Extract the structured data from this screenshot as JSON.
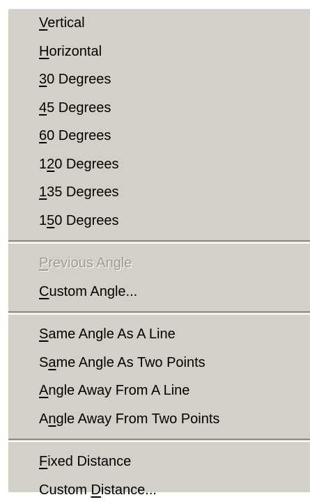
{
  "menu": {
    "groups": [
      {
        "items": [
          {
            "name": "menu-item-vertical",
            "pre": "",
            "key": "V",
            "post": "ertical",
            "enabled": true
          },
          {
            "name": "menu-item-horizontal",
            "pre": "",
            "key": "H",
            "post": "orizontal",
            "enabled": true
          },
          {
            "name": "menu-item-30-degrees",
            "pre": "",
            "key": "3",
            "post": "0 Degrees",
            "enabled": true
          },
          {
            "name": "menu-item-45-degrees",
            "pre": "",
            "key": "4",
            "post": "5 Degrees",
            "enabled": true
          },
          {
            "name": "menu-item-60-degrees",
            "pre": "",
            "key": "6",
            "post": "0 Degrees",
            "enabled": true
          },
          {
            "name": "menu-item-120-degrees",
            "pre": "1",
            "key": "2",
            "post": "0 Degrees",
            "enabled": true
          },
          {
            "name": "menu-item-135-degrees",
            "pre": "",
            "key": "1",
            "post": "35 Degrees",
            "enabled": true
          },
          {
            "name": "menu-item-150-degrees",
            "pre": "1",
            "key": "5",
            "post": "0 Degrees",
            "enabled": true
          }
        ]
      },
      {
        "items": [
          {
            "name": "menu-item-previous-angle",
            "pre": "",
            "key": "P",
            "post": "revious Angle",
            "enabled": false
          },
          {
            "name": "menu-item-custom-angle",
            "pre": "",
            "key": "C",
            "post": "ustom Angle...",
            "enabled": true
          }
        ]
      },
      {
        "items": [
          {
            "name": "menu-item-same-angle-as-a-line",
            "pre": "",
            "key": "S",
            "post": "ame Angle As A Line",
            "enabled": true
          },
          {
            "name": "menu-item-same-angle-as-two-points",
            "pre": "S",
            "key": "a",
            "post": "me Angle As Two Points",
            "enabled": true
          },
          {
            "name": "menu-item-angle-away-from-a-line",
            "pre": "",
            "key": "A",
            "post": "ngle Away From A Line",
            "enabled": true
          },
          {
            "name": "menu-item-angle-away-from-two-points",
            "pre": "A",
            "key": "n",
            "post": "gle Away From Two Points",
            "enabled": true
          }
        ]
      },
      {
        "items": [
          {
            "name": "menu-item-fixed-distance",
            "pre": "",
            "key": "F",
            "post": "ixed Distance",
            "enabled": true
          },
          {
            "name": "menu-item-custom-distance",
            "pre": "Custom ",
            "key": "D",
            "post": "istance...",
            "enabled": true
          }
        ]
      }
    ]
  }
}
